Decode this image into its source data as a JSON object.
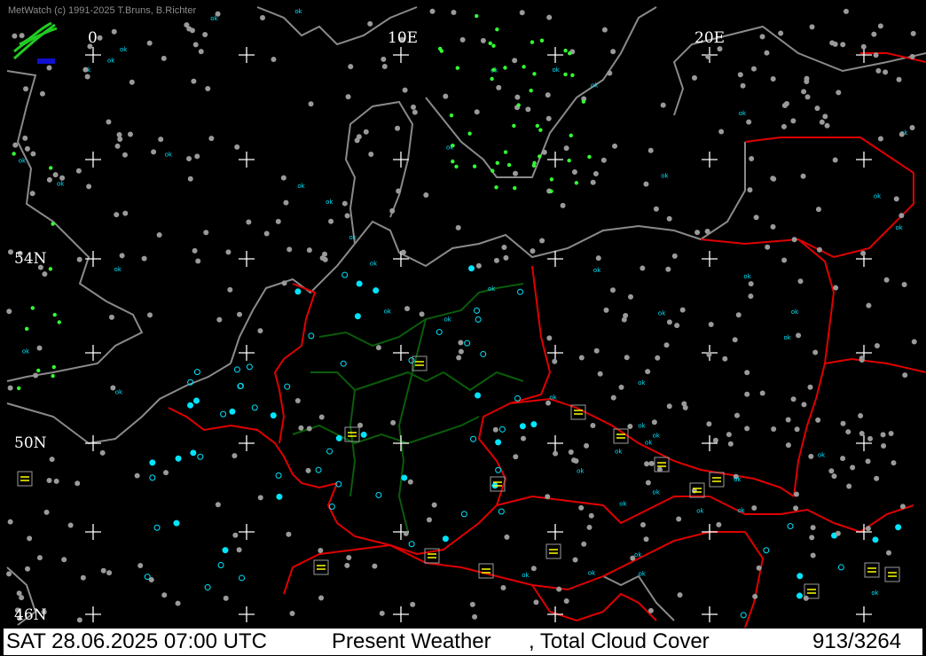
{
  "app": {
    "copyright": "MetWatch  (c) 1991-2025 T.Bruns, B.Richter"
  },
  "grid": {
    "lon_labels": [
      "0",
      "10E",
      "20E"
    ],
    "lat_labels": [
      "54N",
      "50N",
      "46N"
    ]
  },
  "status": {
    "datetime": "SAT 28.06.2025 07:00 UTC",
    "layer1": "Present Weather",
    "layer2": ", Total Cloud Cover",
    "count": "913/3264"
  },
  "colors": {
    "background": "#000000",
    "coastline": "#8a8a8a",
    "border": "#e00000",
    "state_border": "#0a5c0a",
    "grid_cross": "#ffffff",
    "station_clear": "#00e5ff",
    "station_overcast": "#9a9a9a",
    "precip": "#33ff33",
    "fog": "#ffff00"
  },
  "symbols": {
    "ok": "ok",
    "logo": "metwatch-logo-icon"
  }
}
